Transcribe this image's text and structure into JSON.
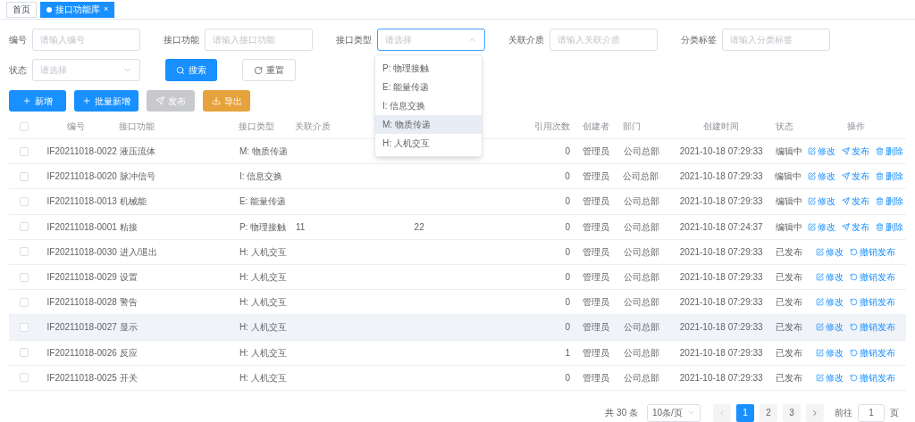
{
  "tags": [
    {
      "label": "首页",
      "selected": false
    },
    {
      "label": "接口功能库",
      "selected": true,
      "close": "×"
    }
  ],
  "filters": [
    [
      {
        "label": "编号",
        "kind": "input",
        "placeholder": "请输入编号"
      },
      {
        "label": "接口功能",
        "kind": "input",
        "placeholder": "请输入接口功能"
      },
      {
        "label": "接口类型",
        "kind": "select",
        "placeholder": "请选择",
        "open": true
      },
      {
        "label": "关联介质",
        "kind": "input",
        "placeholder": "请输入关联介质"
      },
      {
        "label": "分类标签",
        "kind": "input",
        "placeholder": "请输入分类标签"
      }
    ],
    [
      {
        "label": "状态",
        "kind": "select",
        "placeholder": "请选择",
        "open": false
      }
    ]
  ],
  "filter_buttons": [
    {
      "kind": "search",
      "label": "搜索"
    },
    {
      "kind": "reset",
      "label": "重置"
    }
  ],
  "dropdown": [
    {
      "label": "P: 物理接触",
      "highlighted": false
    },
    {
      "label": "E: 能量传递",
      "highlighted": false
    },
    {
      "label": "I: 信息交换",
      "highlighted": false
    },
    {
      "label": "M: 物质传递",
      "highlighted": true
    },
    {
      "label": "H: 人机交互",
      "highlighted": false
    }
  ],
  "actions": [
    {
      "kind": "add",
      "label": "新增",
      "disabled": false
    },
    {
      "kind": "batch",
      "label": "批量新增",
      "disabled": false
    },
    {
      "kind": "publish",
      "label": "发布",
      "disabled": true
    },
    {
      "kind": "export",
      "label": "导出",
      "disabled": false
    }
  ],
  "table": {
    "header_checked": false,
    "columns": [
      "编号",
      "接口功能",
      "接口类型",
      "关联介质",
      "",
      "引用次数",
      "创建者",
      "部门",
      "创建时间",
      "状态",
      "操作"
    ],
    "rows": [
      {
        "checked": false,
        "highlighted": false,
        "cells": [
          "IF20211018-0022",
          "液压流体",
          "M: 物质传递",
          "",
          "",
          "0",
          "管理员",
          "公司总部",
          "2021-10-18 07:29:33",
          "编辑中"
        ],
        "ops": [
          {
            "kind": "edit",
            "label": "修改"
          },
          {
            "kind": "publish",
            "label": "发布"
          },
          {
            "kind": "delete",
            "label": "删除"
          }
        ]
      },
      {
        "checked": false,
        "highlighted": false,
        "cells": [
          "IF20211018-0020",
          "脉冲信号",
          "I: 信息交换",
          "",
          "",
          "0",
          "管理员",
          "公司总部",
          "2021-10-18 07:29:33",
          "编辑中"
        ],
        "ops": [
          {
            "kind": "edit",
            "label": "修改"
          },
          {
            "kind": "publish",
            "label": "发布"
          },
          {
            "kind": "delete",
            "label": "删除"
          }
        ]
      },
      {
        "checked": false,
        "highlighted": false,
        "cells": [
          "IF20211018-0013",
          "机械能",
          "E: 能量传递",
          "",
          "",
          "0",
          "管理员",
          "公司总部",
          "2021-10-18 07:29:33",
          "编辑中"
        ],
        "ops": [
          {
            "kind": "edit",
            "label": "修改"
          },
          {
            "kind": "publish",
            "label": "发布"
          },
          {
            "kind": "delete",
            "label": "删除"
          }
        ]
      },
      {
        "checked": false,
        "highlighted": false,
        "cells": [
          "IF20211018-0001",
          "粘接",
          "P: 物理接触",
          "11",
          "22",
          "0",
          "管理员",
          "公司总部",
          "2021-10-18 07:24:37",
          "编辑中"
        ],
        "ops": [
          {
            "kind": "edit",
            "label": "修改"
          },
          {
            "kind": "publish",
            "label": "发布"
          },
          {
            "kind": "delete",
            "label": "删除"
          }
        ]
      },
      {
        "checked": false,
        "highlighted": false,
        "cells": [
          "IF20211018-0030",
          "进入/退出",
          "H: 人机交互",
          "",
          "",
          "0",
          "管理员",
          "公司总部",
          "2021-10-18 07:29:33",
          "已发布"
        ],
        "ops": [
          {
            "kind": "edit",
            "label": "修改"
          },
          {
            "kind": "revoke",
            "label": "撤销发布"
          }
        ]
      },
      {
        "checked": false,
        "highlighted": false,
        "cells": [
          "IF20211018-0029",
          "设置",
          "H: 人机交互",
          "",
          "",
          "0",
          "管理员",
          "公司总部",
          "2021-10-18 07:29:33",
          "已发布"
        ],
        "ops": [
          {
            "kind": "edit",
            "label": "修改"
          },
          {
            "kind": "revoke",
            "label": "撤销发布"
          }
        ]
      },
      {
        "checked": false,
        "highlighted": false,
        "cells": [
          "IF20211018-0028",
          "警告",
          "H: 人机交互",
          "",
          "",
          "0",
          "管理员",
          "公司总部",
          "2021-10-18 07:29:33",
          "已发布"
        ],
        "ops": [
          {
            "kind": "edit",
            "label": "修改"
          },
          {
            "kind": "revoke",
            "label": "撤销发布"
          }
        ]
      },
      {
        "checked": false,
        "highlighted": true,
        "cells": [
          "IF20211018-0027",
          "显示",
          "H: 人机交互",
          "",
          "",
          "0",
          "管理员",
          "公司总部",
          "2021-10-18 07:29:33",
          "已发布"
        ],
        "ops": [
          {
            "kind": "edit",
            "label": "修改"
          },
          {
            "kind": "revoke",
            "label": "撤销发布"
          }
        ]
      },
      {
        "checked": false,
        "highlighted": false,
        "cells": [
          "IF20211018-0026",
          "反应",
          "H: 人机交互",
          "",
          "",
          "1",
          "管理员",
          "公司总部",
          "2021-10-18 07:29:33",
          "已发布"
        ],
        "ops": [
          {
            "kind": "edit",
            "label": "修改"
          },
          {
            "kind": "revoke",
            "label": "撤销发布"
          }
        ]
      },
      {
        "checked": false,
        "highlighted": false,
        "cells": [
          "IF20211018-0025",
          "开关",
          "H: 人机交互",
          "",
          "",
          "0",
          "管理员",
          "公司总部",
          "2021-10-18 07:29:33",
          "已发布"
        ],
        "ops": [
          {
            "kind": "edit",
            "label": "修改"
          },
          {
            "kind": "revoke",
            "label": "撤销发布"
          }
        ]
      }
    ]
  },
  "pagination": {
    "total": "共 30 条",
    "page_size": "10条/页",
    "pages": [
      {
        "label": "1",
        "selected": true
      },
      {
        "label": "2",
        "selected": false
      },
      {
        "label": "3",
        "selected": false
      }
    ],
    "goto_label": "前往",
    "goto_value": "1",
    "goto_suffix": "页"
  }
}
